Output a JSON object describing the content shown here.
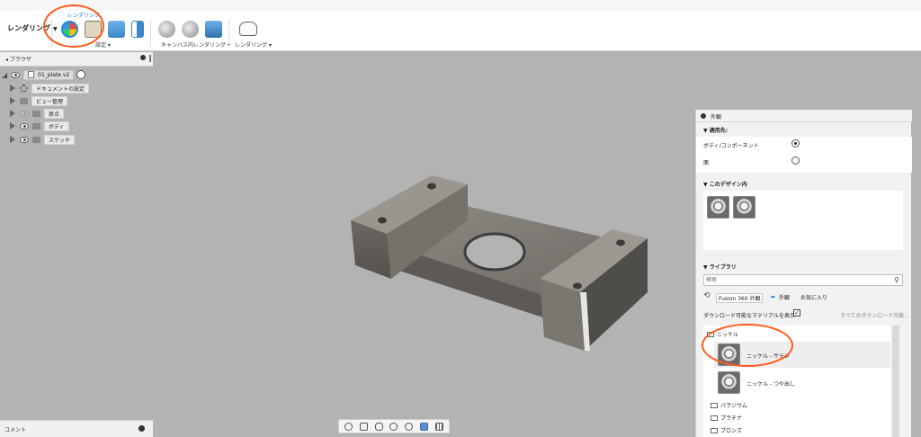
{
  "toolbar": {
    "workspace": "レンダリング",
    "tab_label": "レンダリング",
    "groups": [
      {
        "label": "設定"
      },
      {
        "label": "キャンバス内レンダリング"
      },
      {
        "label": "レンダリング"
      }
    ]
  },
  "browser": {
    "title": "ブラウザ",
    "root": "01_plate v2",
    "items": [
      {
        "label": "ドキュメントの設定"
      },
      {
        "label": "ビュー管理"
      },
      {
        "label": "原点"
      },
      {
        "label": "ボディ"
      },
      {
        "label": "スケッチ"
      }
    ]
  },
  "comments": {
    "title": "コメント"
  },
  "panel": {
    "title": "外観",
    "apply_to": {
      "title": "適用先:",
      "options": [
        {
          "label": "ボディ/コンポーネント",
          "selected": true
        },
        {
          "label": "面",
          "selected": false
        }
      ]
    },
    "in_design": {
      "title": "このデザイン内"
    },
    "library": {
      "title": "ライブラリ",
      "search_placeholder": "検索",
      "tabs": [
        "Fusion 360 外観",
        "外観",
        "お気に入り"
      ],
      "downloadable_label": "ダウンロード可能なマテリアルを表示",
      "download_all": "すべてのダウンロード可能...",
      "downloadable_checked": true,
      "folders": [
        {
          "label": "ニッケル"
        },
        {
          "label": "パラジウム"
        },
        {
          "label": "プラチナ"
        },
        {
          "label": "ブロンズ"
        }
      ],
      "materials": [
        {
          "label": "ニッケル - サテン"
        },
        {
          "label": "ニッケル - つや出し"
        }
      ]
    }
  },
  "colors": {
    "accent": "#2b7bd3",
    "annotation": "#ff5b1a",
    "viewport": "#b3b3b3"
  }
}
